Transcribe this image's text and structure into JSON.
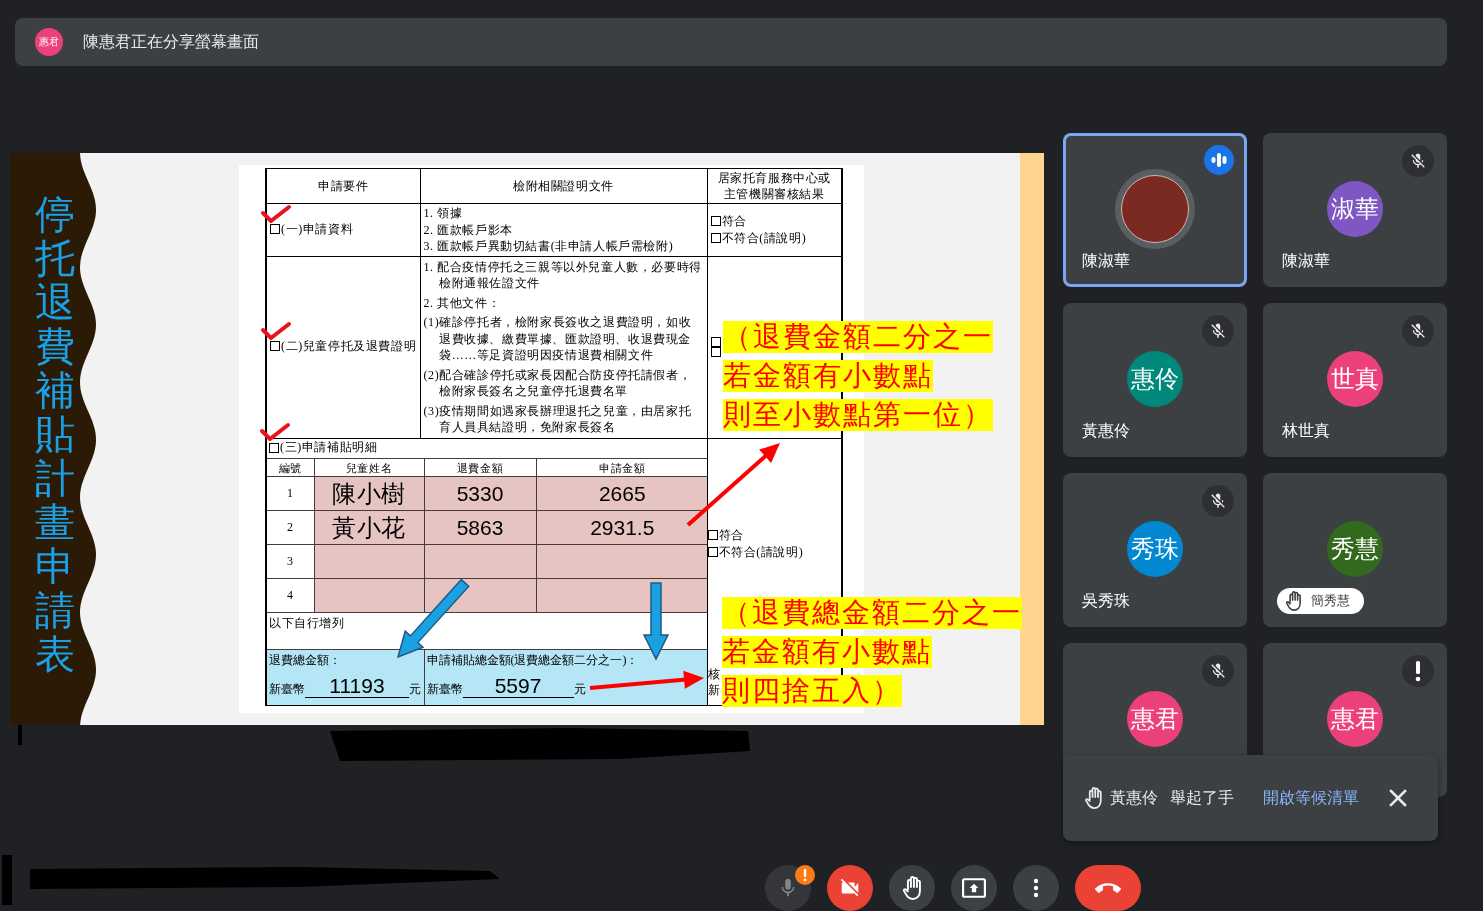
{
  "presenter": {
    "initials": "惠君",
    "color": "#ec407a",
    "message": "陳惠君正在分享螢幕畫面"
  },
  "slide": {
    "title": "停托退費補貼計畫申請表",
    "document": {
      "headers": [
        "申請要件",
        "檢附相關證明文件",
        "居家托育服務中心或主管機關審核結果"
      ],
      "requirements": [
        {
          "label": "(一)申請資料",
          "checked": true,
          "documents": [
            "1. 領據",
            "2. 匯款帳戶影本",
            "3. 匯款帳戶異動切結書(非申請人帳戶需檢附)"
          ],
          "review": [
            {
              "label": "符合",
              "checked": false
            },
            {
              "label": "不符合(請說明)",
              "checked": false
            }
          ]
        },
        {
          "label": "(二)兒童停托及退費證明",
          "checked": true,
          "documents": [
            "1. 配合疫情停托之三親等以外兒童人數，必要時得檢附通報佐證文件",
            "2. 其他文件：",
            "(1)確診停托者，檢附家長簽收之退費證明，如收退費收據、繳費單據、匯款證明、收退費現金袋……等足資證明因疫情退費相關文件",
            "(2)配合確診停托或家長因配合防疫停托請假者，檢附家長簽名之兒童停托退費名單",
            "(3)疫情期間如遇家長辦理退托之兒童，由居家托育人員具結證明，免附家長簽名"
          ],
          "review": [
            {
              "checked": false
            },
            {
              "checked": false
            }
          ]
        }
      ],
      "details": {
        "label": "(三)申請補貼明細",
        "checked": true,
        "columns": [
          "編號",
          "兒童姓名",
          "退費金額",
          "申請金額"
        ],
        "rows": [
          {
            "no": "1",
            "name": "陳小樹",
            "refund": "5330",
            "amount": "2665"
          },
          {
            "no": "2",
            "name": "黃小花",
            "refund": "5863",
            "amount": "2931.5"
          },
          {
            "no": "3"
          },
          {
            "no": "4"
          }
        ],
        "note": "以下自行增列",
        "totals": [
          {
            "label": "退費總金額：",
            "currency": "新臺幣",
            "value": "11193",
            "unit": "元"
          },
          {
            "label": "申請補貼總金額(退費總金額二分之一)：",
            "currency": "新臺幣",
            "value": "5597",
            "unit": "元"
          }
        ],
        "review": [
          {
            "label": "符合",
            "checked": false
          },
          {
            "label": "不符合(請說明)",
            "checked": false
          }
        ],
        "approval_column_fragments": [
          "核",
          "新"
        ]
      }
    },
    "annotations": [
      {
        "lines": [
          "（退費金額二分之一",
          "若金額有小數點",
          "則至小數點第一位）"
        ]
      },
      {
        "lines": [
          "（退費總金額二分之一",
          "若金額有小數點",
          "則四捨五入）"
        ]
      }
    ]
  },
  "participants": [
    {
      "name": "陳淑華",
      "kind": "photo",
      "speaking": true,
      "muted": false,
      "warning": false,
      "hand_raised": false
    },
    {
      "name": "陳淑華",
      "kind": "initials",
      "initials": "淑華",
      "color": "#7e57c2",
      "speaking": false,
      "muted": true,
      "warning": false,
      "hand_raised": false
    },
    {
      "name": "黃惠伶",
      "kind": "initials",
      "initials": "惠伶",
      "color": "#00897b",
      "speaking": false,
      "muted": true,
      "warning": false,
      "hand_raised": false
    },
    {
      "name": "林世真",
      "kind": "initials",
      "initials": "世真",
      "color": "#ec407a",
      "speaking": false,
      "muted": true,
      "warning": false,
      "hand_raised": false
    },
    {
      "name": "吳秀珠",
      "kind": "initials",
      "initials": "秀珠",
      "color": "#0288d1",
      "speaking": false,
      "muted": true,
      "warning": false,
      "hand_raised": false
    },
    {
      "name": "簡秀慧",
      "kind": "initials",
      "initials": "秀慧",
      "color": "#33691e",
      "speaking": false,
      "muted": false,
      "warning": false,
      "hand_raised": true
    },
    {
      "kind": "initials",
      "initials": "惠君",
      "color": "#ec407a",
      "speaking": false,
      "muted": true,
      "warning": false
    },
    {
      "kind": "initials",
      "initials": "惠君",
      "color": "#ec407a",
      "speaking": false,
      "muted": false,
      "warning": true
    }
  ],
  "notification": {
    "name": "黃惠伶",
    "message": "舉起了手",
    "action": "開啟等候清單"
  },
  "controls": [
    {
      "kind": "mic",
      "disabled": true,
      "warning": true
    },
    {
      "kind": "camera",
      "off": true
    },
    {
      "kind": "hand"
    },
    {
      "kind": "present"
    },
    {
      "kind": "more"
    },
    {
      "kind": "leave"
    }
  ]
}
